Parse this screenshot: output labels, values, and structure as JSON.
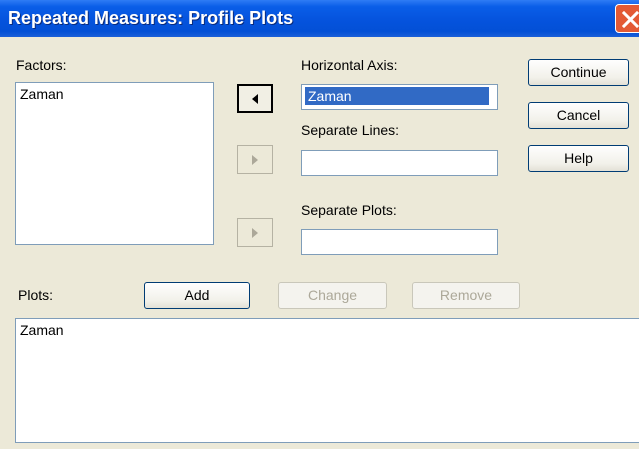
{
  "window": {
    "title": "Repeated Measures: Profile Plots"
  },
  "factors": {
    "label": "Factors:",
    "items": [
      "Zaman"
    ]
  },
  "horizontal_axis": {
    "label": "Horizontal Axis:",
    "value": "Zaman"
  },
  "separate_lines": {
    "label": "Separate Lines:",
    "value": ""
  },
  "separate_plots": {
    "label": "Separate Plots:",
    "value": ""
  },
  "buttons": {
    "continue": "Continue",
    "cancel": "Cancel",
    "help": "Help",
    "add": "Add",
    "change": "Change",
    "remove": "Remove"
  },
  "plots": {
    "label": "Plots:",
    "items": [
      "Zaman"
    ]
  },
  "icons": {
    "close": "close-icon",
    "move_left": "arrow-left-icon",
    "move_right": "arrow-right-icon"
  },
  "colors": {
    "titlebar": "#0553dd",
    "selection": "#316ac5",
    "dialog_bg": "#ece9d8",
    "close": "#e35a35"
  }
}
